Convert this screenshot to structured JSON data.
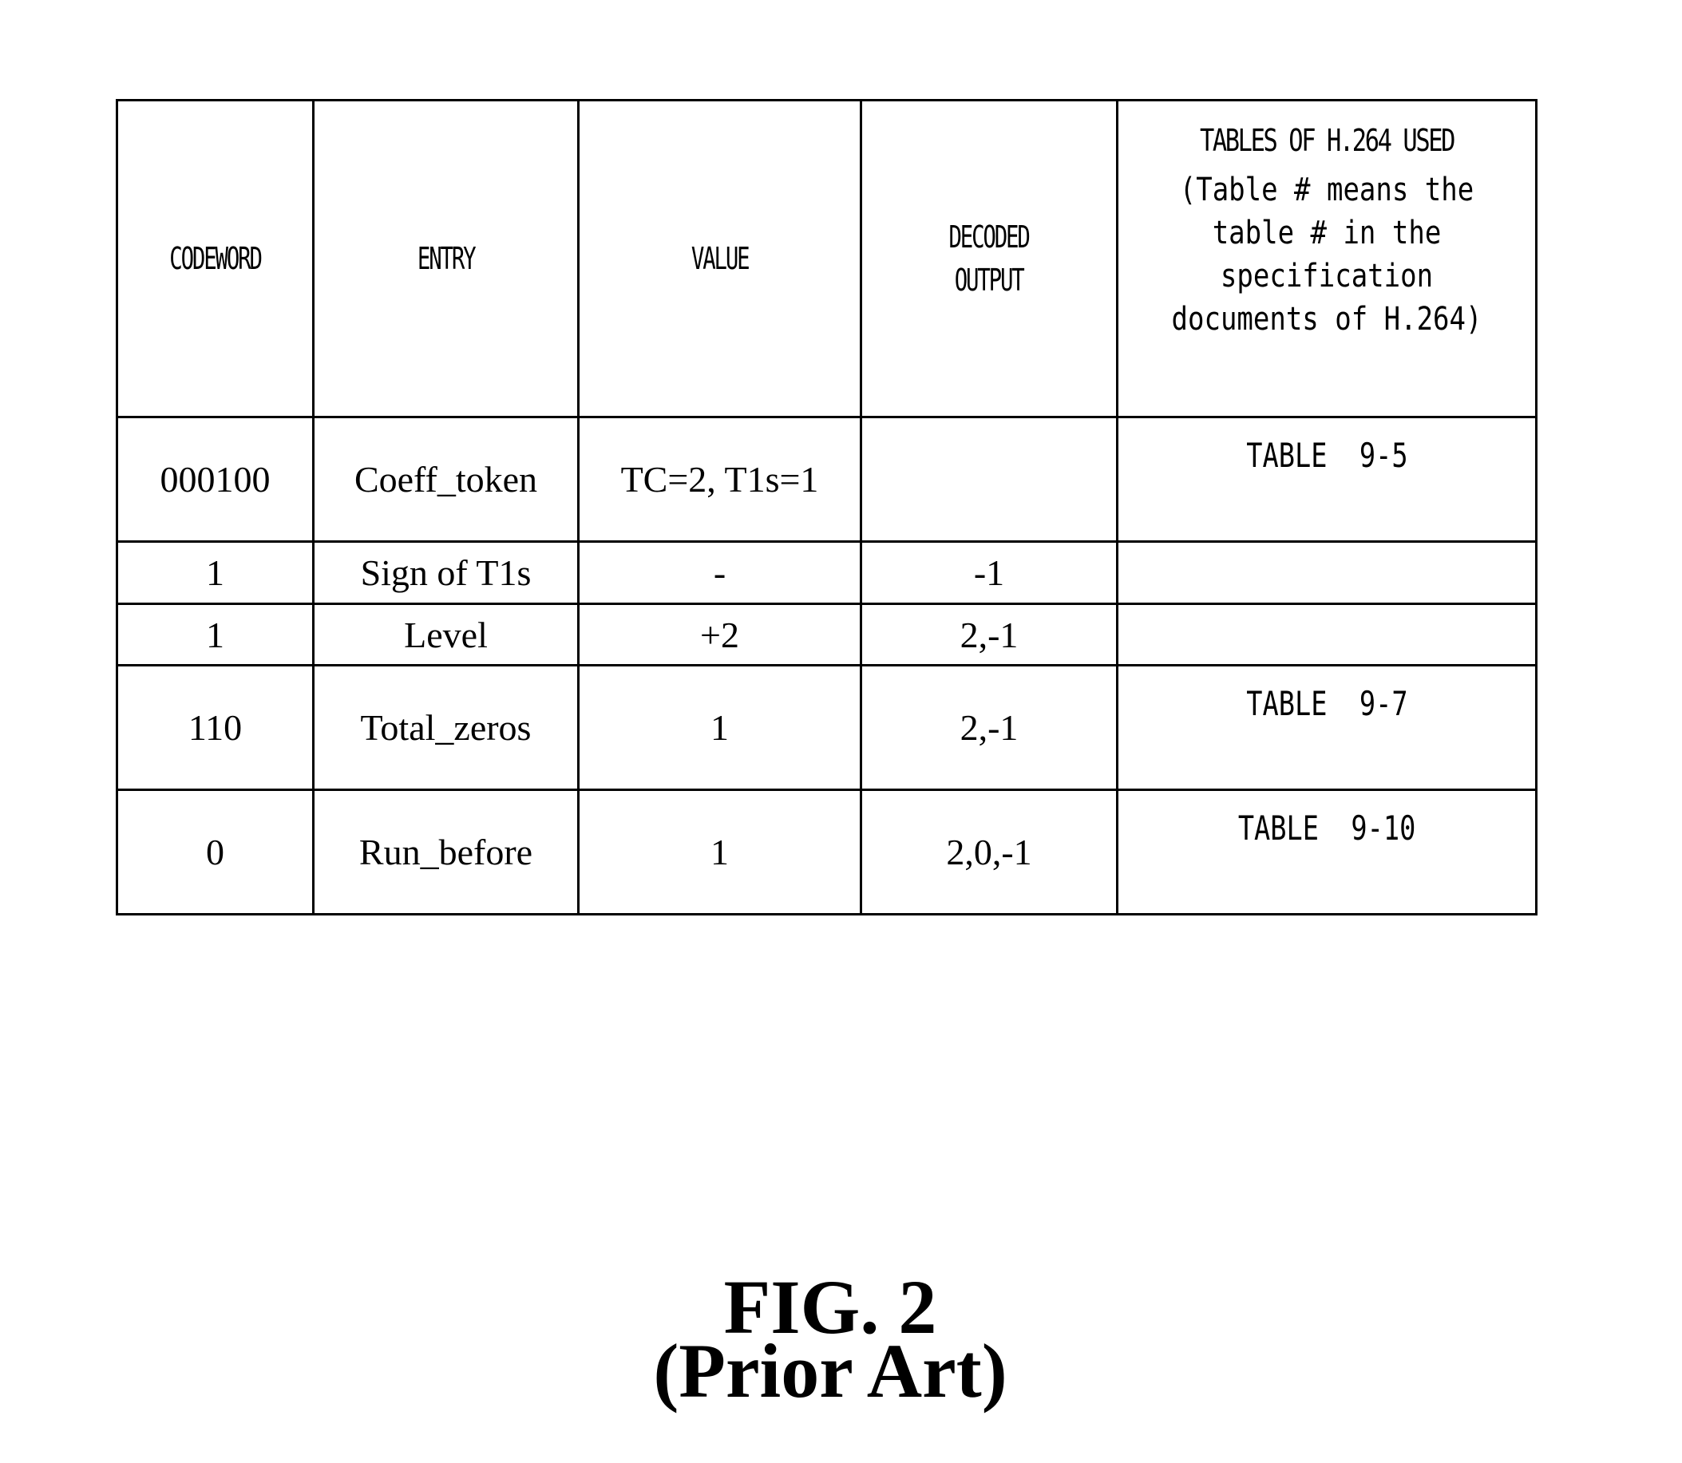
{
  "table": {
    "headers": [
      {
        "lines": [
          "CODEWORD"
        ]
      },
      {
        "lines": [
          "ENTRY"
        ]
      },
      {
        "lines": [
          "VALUE"
        ]
      },
      {
        "lines": [
          "DECODED",
          "OUTPUT"
        ]
      },
      {
        "title": "TABLES OF H.264 USED",
        "note_lines": [
          "(Table # means the",
          "table # in the",
          "specification",
          "documents of H.264)"
        ]
      }
    ],
    "rows": [
      {
        "codeword": "000100",
        "entry": "Coeff_token",
        "value": "TC=2, T1s=1",
        "decoded": "",
        "table_ref": "TABLE  9-5"
      },
      {
        "codeword": "1",
        "entry": "Sign of T1s",
        "value": "-",
        "decoded": "-1",
        "table_ref": ""
      },
      {
        "codeword": "1",
        "entry": "Level",
        "value": "+2",
        "decoded": "2,-1",
        "table_ref": ""
      },
      {
        "codeword": "110",
        "entry": "Total_zeros",
        "value": "1",
        "decoded": "2,-1",
        "table_ref": "TABLE  9-7"
      },
      {
        "codeword": "0",
        "entry": "Run_before",
        "value": "1",
        "decoded": "2,0,-1",
        "table_ref": "TABLE  9-10"
      }
    ]
  },
  "caption": {
    "figure": "FIG. 2",
    "subtitle": "(Prior Art)"
  }
}
